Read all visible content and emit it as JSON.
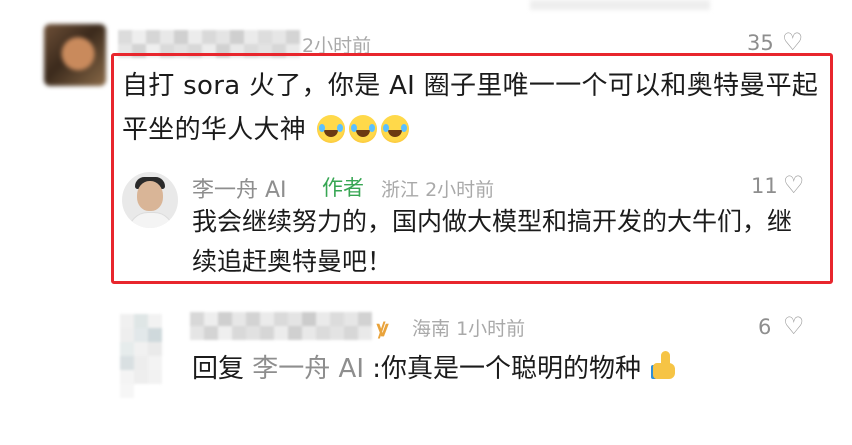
{
  "comment1": {
    "time": "2小时前",
    "likes": "35",
    "text": "自打 sora 火了，你是 AI 圈子里唯一一个可以和奥特曼平起平坐的华人大神"
  },
  "reply": {
    "name": "李一舟 AI",
    "author_badge": "作者",
    "location": "浙江",
    "time": "2小时前",
    "likes": "11",
    "text": "我会继续努力的，国内做大模型和搞开发的大牛们，继续追赶奥特曼吧！"
  },
  "comment2": {
    "location": "海南",
    "time": "1小时前",
    "likes": "6",
    "reply_prefix": "回复",
    "mention": "李一舟 AI",
    "text": ":你真是一个聪明的物种"
  },
  "icons": {
    "like": "heart-outline-icon",
    "laugh": "laughing-tears-emoji",
    "thumbs_up": "thumbs-up-emoji"
  },
  "colors": {
    "highlight": "#e8262d",
    "author_badge": "#37a653",
    "meta": "#a9a9a9"
  }
}
